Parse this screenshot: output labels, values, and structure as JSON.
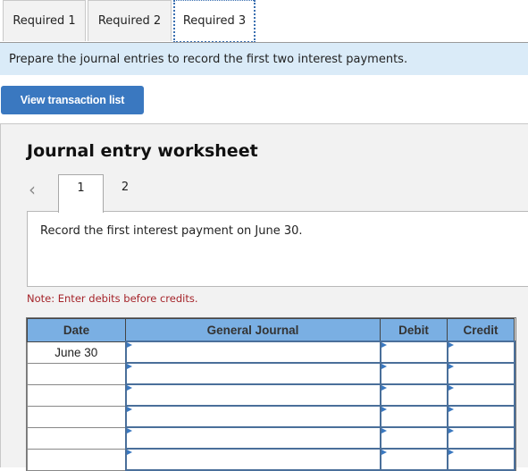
{
  "tabs": [
    {
      "label": "Required 1",
      "active": false
    },
    {
      "label": "Required 2",
      "active": false
    },
    {
      "label": "Required 3",
      "active": true
    }
  ],
  "instruction": "Prepare the journal entries to record the first two interest payments.",
  "view_transaction_button": "View transaction list",
  "worksheet": {
    "title": "Journal entry worksheet",
    "prev_icon": "chevron-left-icon",
    "pages": [
      "1",
      "2"
    ],
    "active_page": "1",
    "description": "Record the first interest payment on June 30.",
    "note": "Note: Enter debits before credits.",
    "columns": [
      "Date",
      "General Journal",
      "Debit",
      "Credit"
    ],
    "rows": [
      {
        "date": "June 30",
        "account": "",
        "debit": "",
        "credit": ""
      },
      {
        "date": "",
        "account": "",
        "debit": "",
        "credit": ""
      },
      {
        "date": "",
        "account": "",
        "debit": "",
        "credit": ""
      },
      {
        "date": "",
        "account": "",
        "debit": "",
        "credit": ""
      },
      {
        "date": "",
        "account": "",
        "debit": "",
        "credit": ""
      },
      {
        "date": "",
        "account": "",
        "debit": "",
        "credit": ""
      }
    ]
  },
  "colors": {
    "accent_button": "#3a78c0",
    "instruction_bg": "#daebf8",
    "table_header_bg": "#7aafe3",
    "note_text": "#a5242a"
  }
}
